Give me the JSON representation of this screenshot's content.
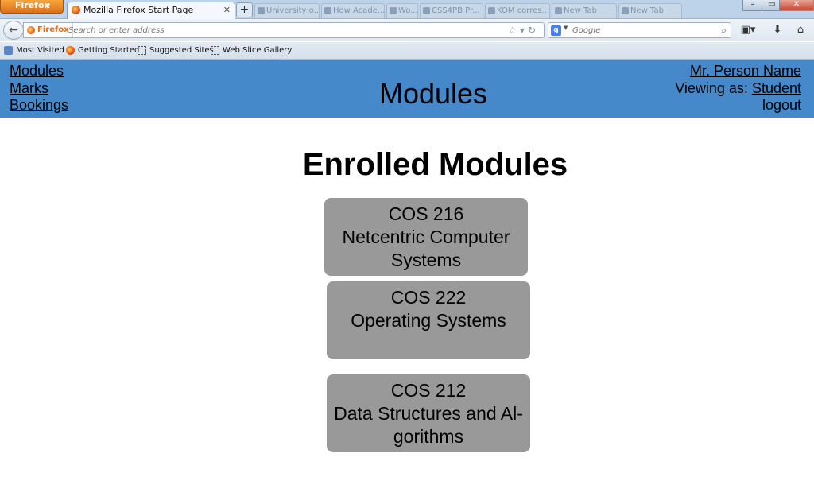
{
  "browser": {
    "menu_label": "Firefox",
    "active_tab_title": "Mozilla Firefox Start Page",
    "background_tabs": [
      "University o...",
      "How Acade...",
      "Wo...",
      "CSS4PB Pr...",
      "KOM corres...",
      "New Tab",
      "New Tab"
    ],
    "identity_label": "Firefox",
    "address_placeholder": "Search or enter address",
    "search_engine": "Google",
    "search_placeholder": "Google",
    "window_controls": {
      "minimize": "–",
      "restore": "▭",
      "close": "✕"
    },
    "bookmarks": [
      {
        "label": "Most Visited",
        "icon": "most-visited-icon"
      },
      {
        "label": "Getting Started",
        "icon": "firefox-icon"
      },
      {
        "label": "Suggested Sites",
        "icon": "dashed-page-icon"
      },
      {
        "label": "Web Slice Gallery",
        "icon": "dashed-page-icon"
      }
    ]
  },
  "site": {
    "header_color": "#4589cb",
    "nav": {
      "modules": "Modules",
      "marks": "Marks",
      "bookings": "Bookings"
    },
    "header_title": "Modules",
    "user": {
      "name": "Mr. Person Name",
      "viewing_as_label": "Viewing as:",
      "role": "Student",
      "logout": "logout"
    }
  },
  "main": {
    "section_title": "Enrolled Modules",
    "card_color": "#999999",
    "modules": [
      {
        "code": "COS 216",
        "name": "Netcentric Computer Systems"
      },
      {
        "code": "COS 222",
        "name": "Operating Systems"
      },
      {
        "code": "COS 212",
        "name": "Data Structures and Al-gorithms"
      }
    ]
  }
}
